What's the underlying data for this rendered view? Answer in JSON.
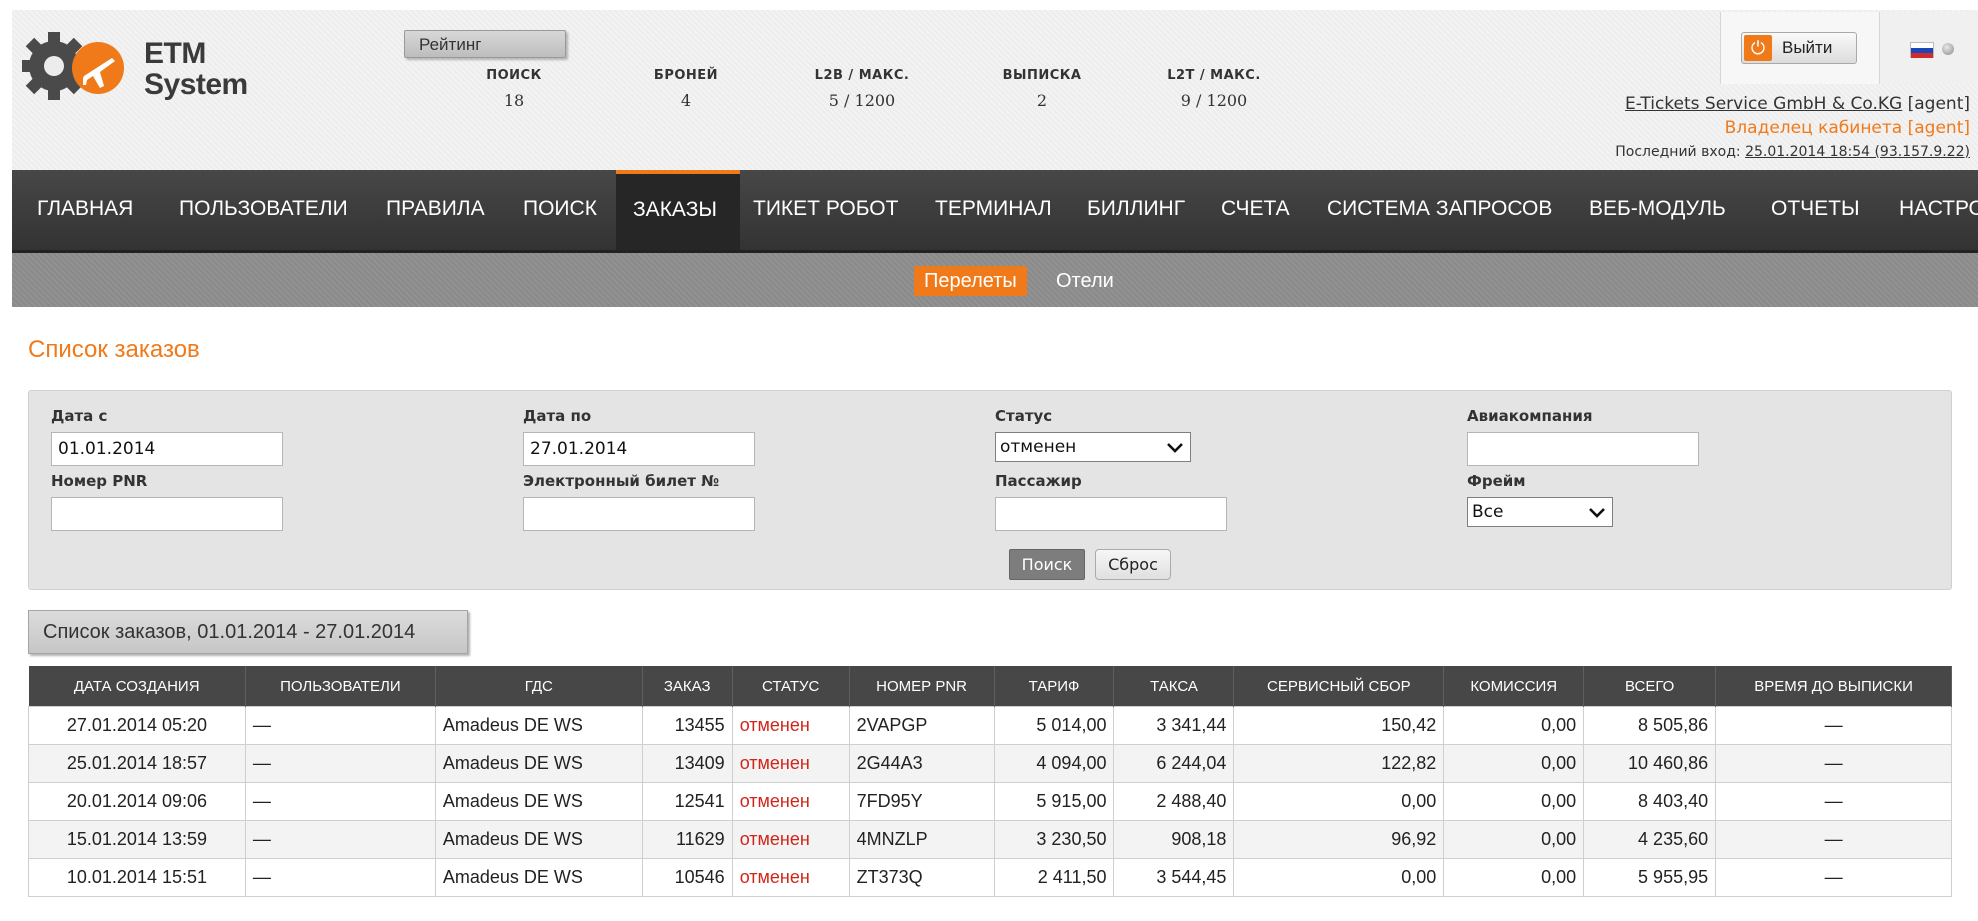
{
  "brand": {
    "line1": "ETM",
    "line2": "System"
  },
  "rating_label": "Рейтинг",
  "stats": [
    {
      "label": "ПОИСК",
      "value": "18"
    },
    {
      "label": "БРОНЕЙ",
      "value": "4"
    },
    {
      "label": "L2B / МАКС.",
      "value": "5 / 1200"
    },
    {
      "label": "ВЫПИСКА",
      "value": "2"
    },
    {
      "label": "L2T / МАКС.",
      "value": "9 / 1200"
    }
  ],
  "logout_label": "Выйти",
  "account": {
    "company": "E-Tickets Service GmbH & Co.KG",
    "company_role": "[agent]",
    "owner": "Владелец кабинета [agent]",
    "last_login_label": "Последний вход:",
    "last_login_value": "25.01.2014 18:54 (93.157.9.22)"
  },
  "nav": [
    "ГЛАВНАЯ",
    "ПОЛЬЗОВАТЕЛИ",
    "ПРАВИЛА",
    "ПОИСК",
    "ЗАКАЗЫ",
    "ТИКЕТ РОБОТ",
    "ТЕРМИНАЛ",
    "БИЛЛИНГ",
    "СЧЕТА",
    "СИСТЕМА ЗАПРОСОВ",
    "ВЕБ-МОДУЛЬ",
    "ОТЧЕТЫ",
    "НАСТРО"
  ],
  "nav_active": "ЗАКАЗЫ",
  "subnav": [
    "Перелеты",
    "Отели"
  ],
  "page_title": "Список заказов",
  "filter": {
    "date_from_label": "Дата с",
    "date_from_value": "01.01.2014",
    "date_to_label": "Дата по",
    "date_to_value": "27.01.2014",
    "status_label": "Статус",
    "status_value": "отменен",
    "airline_label": "Авиакомпания",
    "airline_value": "",
    "pnr_label": "Номер PNR",
    "pnr_value": "",
    "ticket_label": "Электронный билет №",
    "ticket_value": "",
    "passenger_label": "Пассажир",
    "passenger_value": "",
    "frame_label": "Фрейм",
    "frame_value": "Все",
    "search_button": "Поиск",
    "reset_button": "Сброс"
  },
  "list_range_label": "Список заказов, 01.01.2014 - 27.01.2014",
  "table": {
    "headers": [
      "ДАТА СОЗДАНИЯ",
      "ПОЛЬЗОВАТЕЛИ",
      "ГДС",
      "ЗАКАЗ",
      "СТАТУС",
      "НОМЕР PNR",
      "ТАРИФ",
      "ТАКСА",
      "СЕРВИСНЫЙ СБОР",
      "КОМИССИЯ",
      "ВСЕГО",
      "ВРЕМЯ ДО ВЫПИСКИ"
    ],
    "rows": [
      [
        "27.01.2014 05:20",
        "—",
        "Amadeus DE WS",
        "13455",
        "отменен",
        "2VAPGP",
        "5 014,00",
        "3 341,44",
        "150,42",
        "0,00",
        "8 505,86",
        "—"
      ],
      [
        "25.01.2014 18:57",
        "—",
        "Amadeus DE WS",
        "13409",
        "отменен",
        "2G44A3",
        "4 094,00",
        "6 244,04",
        "122,82",
        "0,00",
        "10 460,86",
        "—"
      ],
      [
        "20.01.2014 09:06",
        "—",
        "Amadeus DE WS",
        "12541",
        "отменен",
        "7FD95Y",
        "5 915,00",
        "2 488,40",
        "0,00",
        "0,00",
        "8 403,40",
        "—"
      ],
      [
        "15.01.2014 13:59",
        "—",
        "Amadeus DE WS",
        "11629",
        "отменен",
        "4MNZLP",
        "3 230,50",
        "908,18",
        "96,92",
        "0,00",
        "4 235,60",
        "—"
      ],
      [
        "10.01.2014 15:51",
        "—",
        "Amadeus DE WS",
        "10546",
        "отменен",
        "ZT373Q",
        "2 411,50",
        "3 544,45",
        "0,00",
        "0,00",
        "5 955,95",
        "—"
      ]
    ]
  },
  "colors": {
    "accent": "#f07a1a",
    "nav_bg": "#3c3c3c",
    "status_cancelled": "#d0261a"
  }
}
